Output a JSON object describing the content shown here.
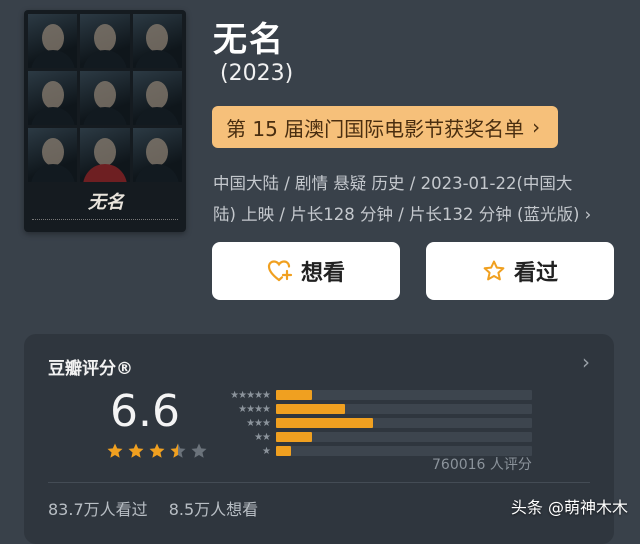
{
  "movie": {
    "title": "无名",
    "year": "(2023)",
    "award_banner": "第 15 届澳门国际电影节获奖名单",
    "meta_line1": "中国大陆 / 剧情 悬疑 历史 / 2023-01-22(中国大",
    "meta_line2": "陆) 上映 / 片长128 分钟 / 片长132 分钟 (蓝光版)",
    "poster_logo": "无名"
  },
  "actions": {
    "want_label": "想看",
    "seen_label": "看过"
  },
  "rating": {
    "header": "豆瓣评分®",
    "score": "6.6",
    "stars": 3.5,
    "votes": "760016 人评分",
    "distribution": [
      {
        "label": "★★★★★",
        "fraction": 0.14
      },
      {
        "label": "★★★★",
        "fraction": 0.27
      },
      {
        "label": "★★★",
        "fraction": 0.38
      },
      {
        "label": "★★",
        "fraction": 0.14
      },
      {
        "label": "★",
        "fraction": 0.06
      }
    ],
    "seen_count": "83.7万人看过",
    "want_count": "8.5万人想看"
  },
  "colors": {
    "accent": "#f0a020",
    "award_bg": "#f6c07a",
    "background": "#39414a"
  },
  "watermark": "头条 @萌神木木"
}
